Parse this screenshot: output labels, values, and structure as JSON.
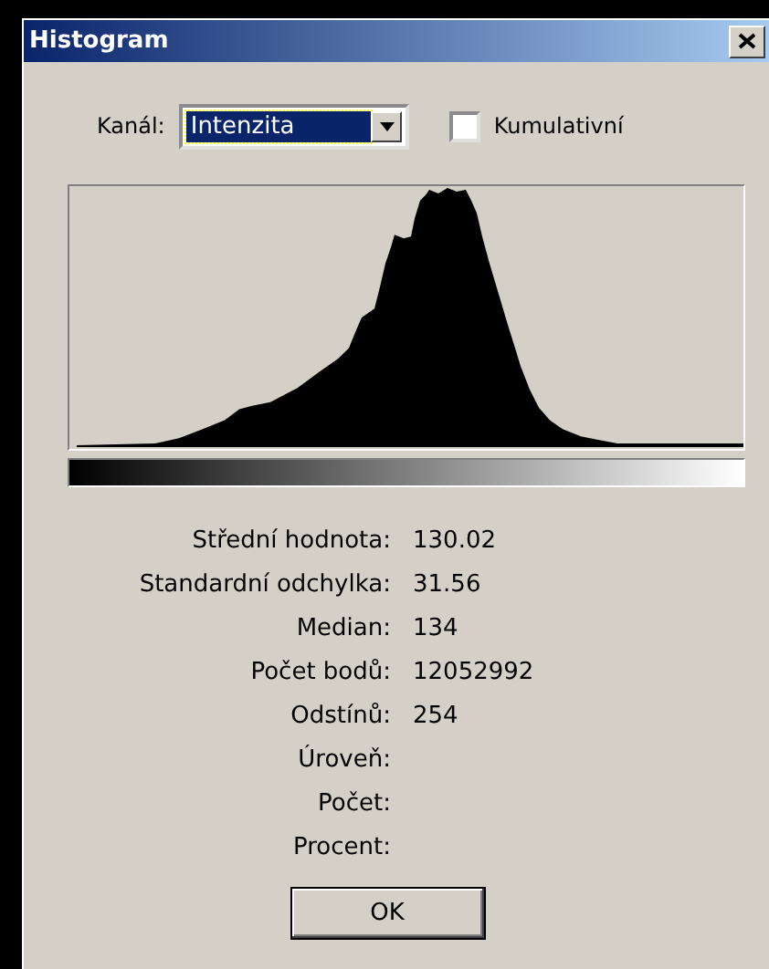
{
  "window": {
    "title": "Histogram"
  },
  "channel": {
    "label": "Kanál:",
    "value": "Intenzita"
  },
  "cumulative": {
    "label": "Kumulativní",
    "checked": false
  },
  "stats": [
    {
      "label": "Střední hodnota:",
      "value": "130.02"
    },
    {
      "label": "Standardní odchylka:",
      "value": "31.56"
    },
    {
      "label": "Median:",
      "value": "134"
    },
    {
      "label": "Počet bodů:",
      "value": "12052992"
    },
    {
      "label": "Odstínů:",
      "value": "254"
    },
    {
      "label": "Úroveň:"
    },
    {
      "label": "Počet:"
    },
    {
      "label": "Procent:"
    }
  ],
  "buttons": [
    "OK"
  ]
}
